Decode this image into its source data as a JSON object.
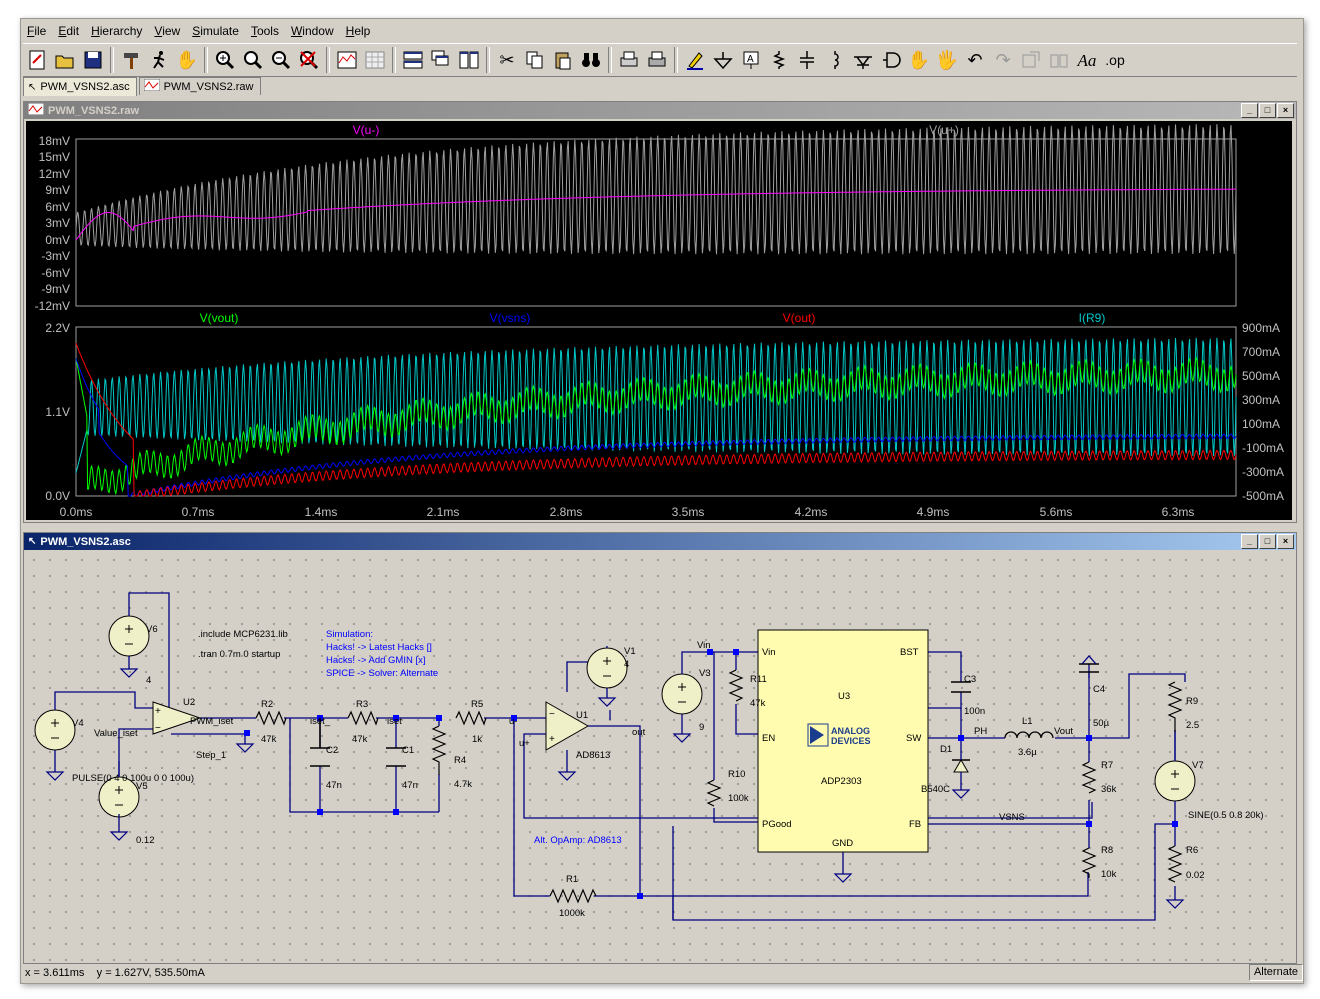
{
  "menu": [
    "File",
    "Edit",
    "Hierarchy",
    "View",
    "Simulate",
    "Tools",
    "Window",
    "Help"
  ],
  "tabs": [
    {
      "label": "PWM_VSNS2.asc",
      "icon": "schematic-icon",
      "active": true
    },
    {
      "label": "PWM_VSNS2.raw",
      "icon": "waveform-icon",
      "active": false
    }
  ],
  "waveform_window": {
    "title": "PWM_VSNS2.raw",
    "pane1": {
      "traces": [
        {
          "label": "V(u-)",
          "color": "#ff00ff"
        },
        {
          "label": "V(u+)",
          "color": "#a0a0a0"
        }
      ],
      "yticks": [
        "18mV",
        "15mV",
        "12mV",
        "9mV",
        "6mV",
        "3mV",
        "0mV",
        "-3mV",
        "-6mV",
        "-9mV",
        "-12mV"
      ]
    },
    "pane2": {
      "traces": [
        {
          "label": "V(vout)",
          "color": "#00ff00"
        },
        {
          "label": "V(vsns)",
          "color": "#0000ff"
        },
        {
          "label": "V(out)",
          "color": "#ff0000"
        },
        {
          "label": "I(R9)",
          "color": "#00c8c8"
        }
      ],
      "yticks_left": [
        "2.2V",
        "1.1V",
        "0.0V"
      ],
      "yticks_right": [
        "900mA",
        "700mA",
        "500mA",
        "300mA",
        "100mA",
        "-100mA",
        "-300mA",
        "-500mA"
      ]
    },
    "xticks": [
      "0.0ms",
      "0.7ms",
      "1.4ms",
      "2.1ms",
      "2.8ms",
      "3.5ms",
      "4.2ms",
      "4.9ms",
      "5.6ms",
      "6.3ms"
    ]
  },
  "schematic_window": {
    "title": "PWM_VSNS2.asc",
    "directives": [
      ".include MCP6231.lib",
      ".tran 0 7m 0 startup"
    ],
    "sim_notes": [
      "Simulation:",
      "Hacks! -> Latest Hacks []",
      "Hacks! -> Add GMIN [x]",
      "SPICE -> Solver: Alternate"
    ],
    "alt_note": "Alt. OpAmp: AD8613",
    "components": {
      "V6": "V6",
      "V6_val": "4",
      "V4": "V4",
      "V4_val": "PULSE(0 4 0 100u 0 0 100u)",
      "V5": "V5",
      "V5_val": "0.12",
      "U2": "U2",
      "R2": "R2",
      "R2_val": "47k",
      "R3": "R3",
      "R3_val": "47k",
      "C2": "C2",
      "C2_val": "47n",
      "C1": "C1",
      "C1_val": "47n",
      "R4": "R4",
      "R4_val": "4.7k",
      "R5": "R5",
      "R5_val": "1k",
      "U1": "U1",
      "U1_val": "AD8613",
      "V1": "V1",
      "V1_val": "4",
      "R1": "R1",
      "R1_val": "1000k",
      "V3": "V3",
      "V3_val": "9",
      "R11": "R11",
      "R11_val": "47k",
      "R10": "R10",
      "R10_val": "100k",
      "U3": "U3",
      "U3_val": "ADP2303",
      "C3": "C3",
      "C3_val": "100n",
      "D1": "D1",
      "D1_val": "B540C",
      "L1": "L1",
      "L1_val": "3.6µ",
      "C4": "C4",
      "C4_val": "50µ",
      "R7": "R7",
      "R7_val": "36k",
      "R8": "R8",
      "R8_val": "10k",
      "R9": "R9",
      "R9_val": "2.5",
      "R6": "R6",
      "R6_val": "0.02",
      "V7": "V7",
      "V7_val": "SINE(0.5 0.8 20k)"
    },
    "chip_pins": {
      "vin": "Vin",
      "en": "EN",
      "pgood": "PGood",
      "bst": "BST",
      "sw": "SW",
      "fb": "FB",
      "gnd": "GND"
    },
    "chip_logo": [
      "ANALOG",
      "DEVICES"
    ],
    "nets": {
      "value_iset": "Value_iset",
      "pwm_iset": "PWM_iset",
      "step_1": "Step_1",
      "iset_a": "iset_",
      "iset_b": "iset",
      "u_minus": "u-",
      "u_plus": "u+",
      "out": "out",
      "vin": "Vin",
      "ph": "PH",
      "vout": "Vout",
      "vsns": "VSNS"
    }
  },
  "status": {
    "coords": "x = 3.611ms    y = 1.627V, 535.50mA",
    "mode": "Alternate"
  }
}
